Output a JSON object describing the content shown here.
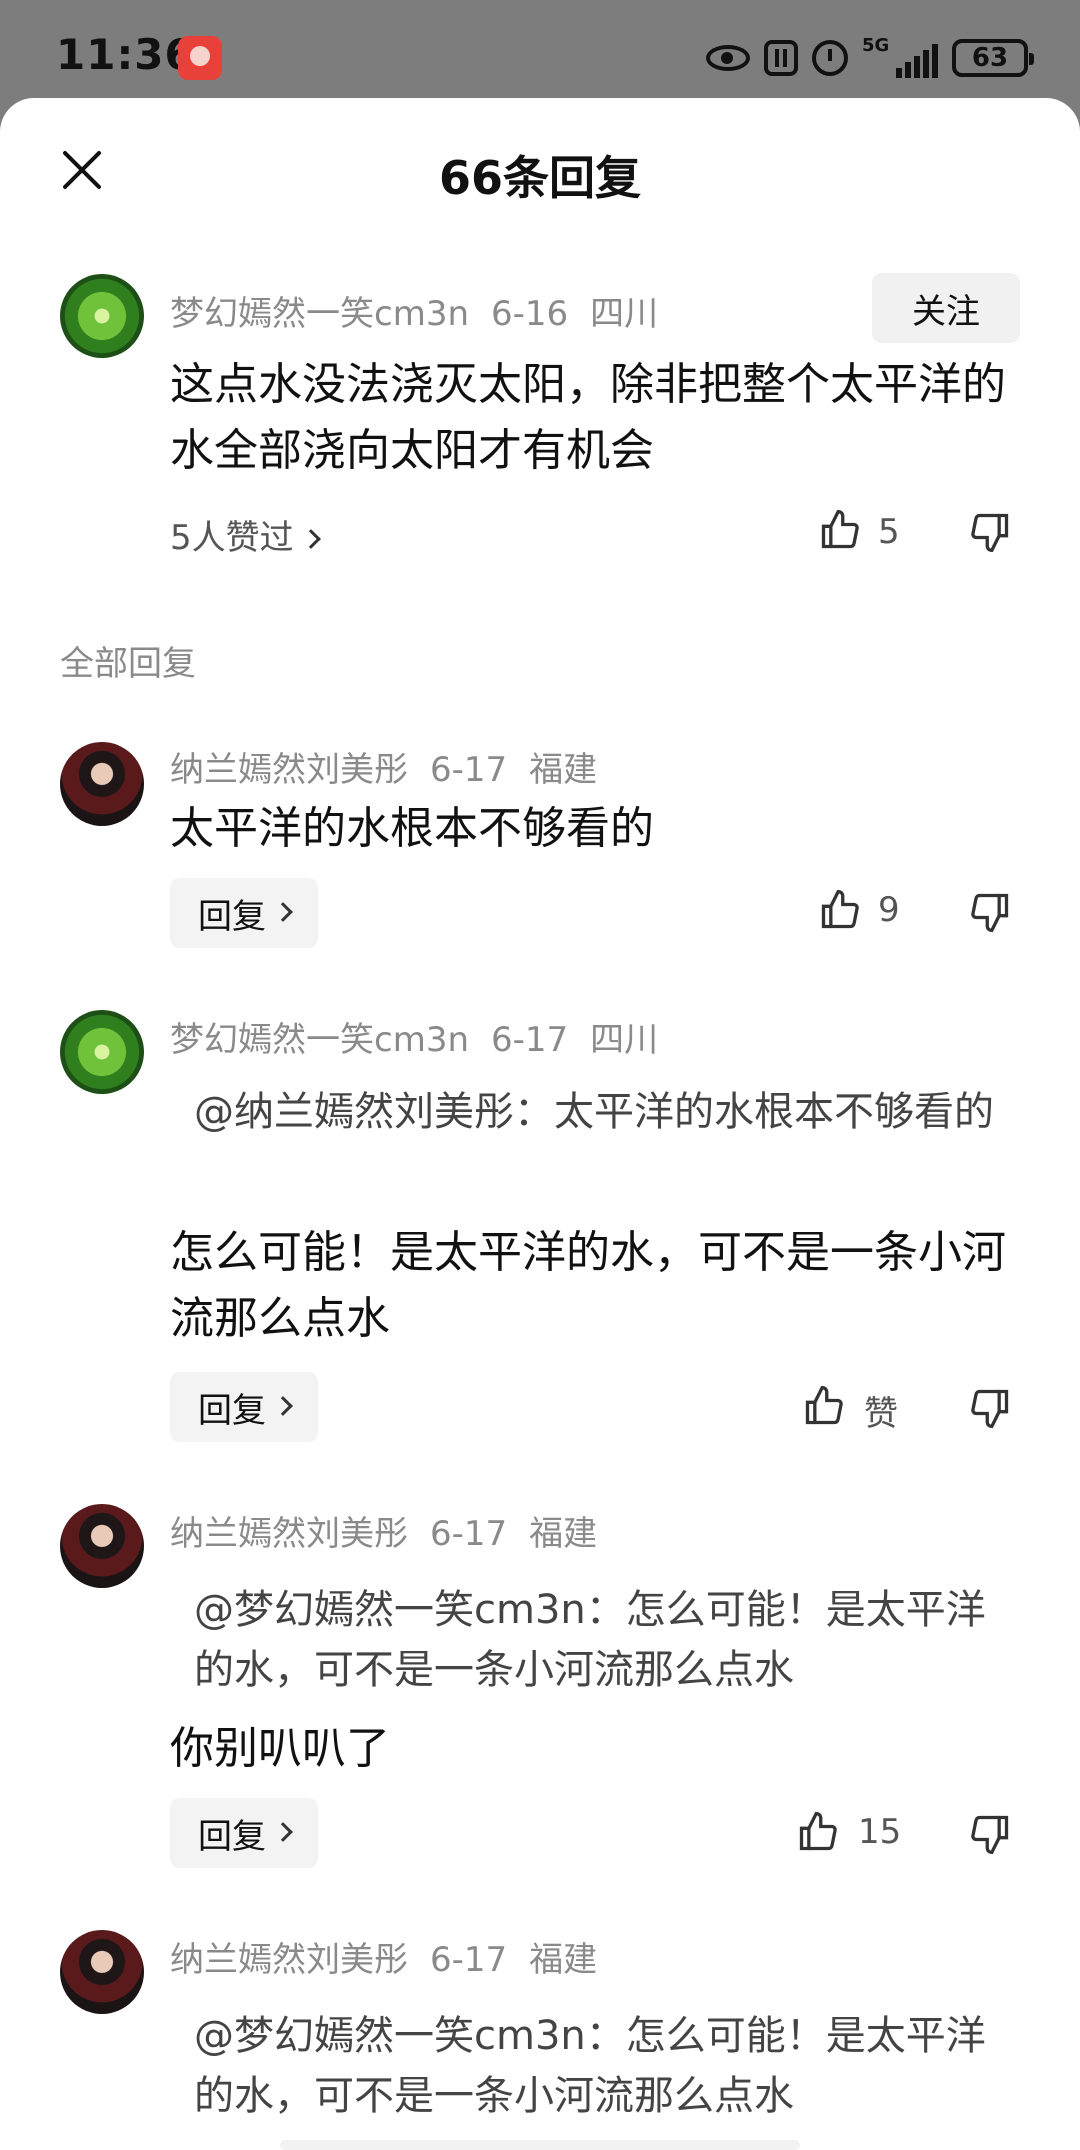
{
  "status_bar": {
    "time": "11:36",
    "network": "5G",
    "battery": "63"
  },
  "header": {
    "title": "66条回复"
  },
  "main_comment": {
    "username": "梦幻嫣然一笑cm3n",
    "date": "6-16",
    "location": "四川",
    "follow_label": "关注",
    "text": "这点水没法浇灭太阳，除非把整个太平洋的水全部浇向太阳才有机会",
    "liked_by": "5人赞过",
    "like_count": "5"
  },
  "section_label": "全部回复",
  "replies": [
    {
      "username": "纳兰嫣然刘美彤",
      "date": "6-17",
      "location": "福建",
      "quote": "",
      "text": "太平洋的水根本不够看的",
      "reply_label": "回复",
      "like_count": "9"
    },
    {
      "username": "梦幻嫣然一笑cm3n",
      "date": "6-17",
      "location": "四川",
      "quote": "@纳兰嫣然刘美彤：太平洋的水根本不够看的",
      "text": "怎么可能！是太平洋的水，可不是一条小河流那么点水",
      "reply_label": "回复",
      "like_count": "赞"
    },
    {
      "username": "纳兰嫣然刘美彤",
      "date": "6-17",
      "location": "福建",
      "quote": "@梦幻嫣然一笑cm3n：怎么可能！是太平洋的水，可不是一条小河流那么点水",
      "text": "你别叭叭了",
      "reply_label": "回复",
      "like_count": "15"
    },
    {
      "username": "纳兰嫣然刘美彤",
      "date": "6-17",
      "location": "福建",
      "quote": "@梦幻嫣然一笑cm3n：怎么可能！是太平洋的水，可不是一条小河流那么点水",
      "text": "",
      "reply_label": "",
      "like_count": ""
    }
  ]
}
